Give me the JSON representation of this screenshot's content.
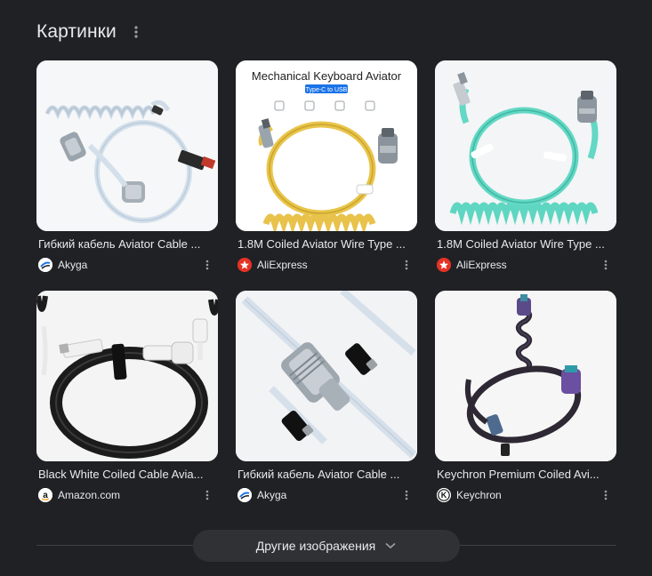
{
  "section": {
    "title": "Картинки"
  },
  "results": [
    {
      "caption": "Гибкий кабель Aviator Cable ...",
      "source": "Akyga",
      "favicon": "akyga-logo-icon",
      "image": "light-blue-coiled-aviator-cable"
    },
    {
      "caption": "1.8M Coiled Aviator Wire Type ...",
      "source": "AliExpress",
      "favicon": "aliexpress-logo-icon",
      "image": "yellow-coiled-aviator-cable",
      "image_text": {
        "headline": "Mechanical Keyboard Aviator",
        "tag": "Type-C to USB"
      }
    },
    {
      "caption": "1.8M Coiled Aviator Wire Type ...",
      "source": "AliExpress",
      "favicon": "aliexpress-logo-icon",
      "image": "mint-coiled-aviator-cable"
    },
    {
      "caption": "Black White Coiled Cable Avia...",
      "source": "Amazon.com",
      "favicon": "amazon-logo-icon",
      "image": "black-white-coiled-cable"
    },
    {
      "caption": "Гибкий кабель Aviator Cable ...",
      "source": "Akyga",
      "favicon": "akyga-logo-icon",
      "image": "aviator-connector-closeup"
    },
    {
      "caption": "Keychron Premium Coiled Avi...",
      "source": "Keychron",
      "favicon": "keychron-logo-icon",
      "image": "keychron-premium-coiled-cable"
    }
  ],
  "footer": {
    "more_images_label": "Другие изображения"
  },
  "colors": {
    "background": "#202124",
    "text": "#e8eaed",
    "secondary": "#9aa0a6",
    "button_bg": "#303134",
    "aliexpress_red": "#e43225"
  }
}
